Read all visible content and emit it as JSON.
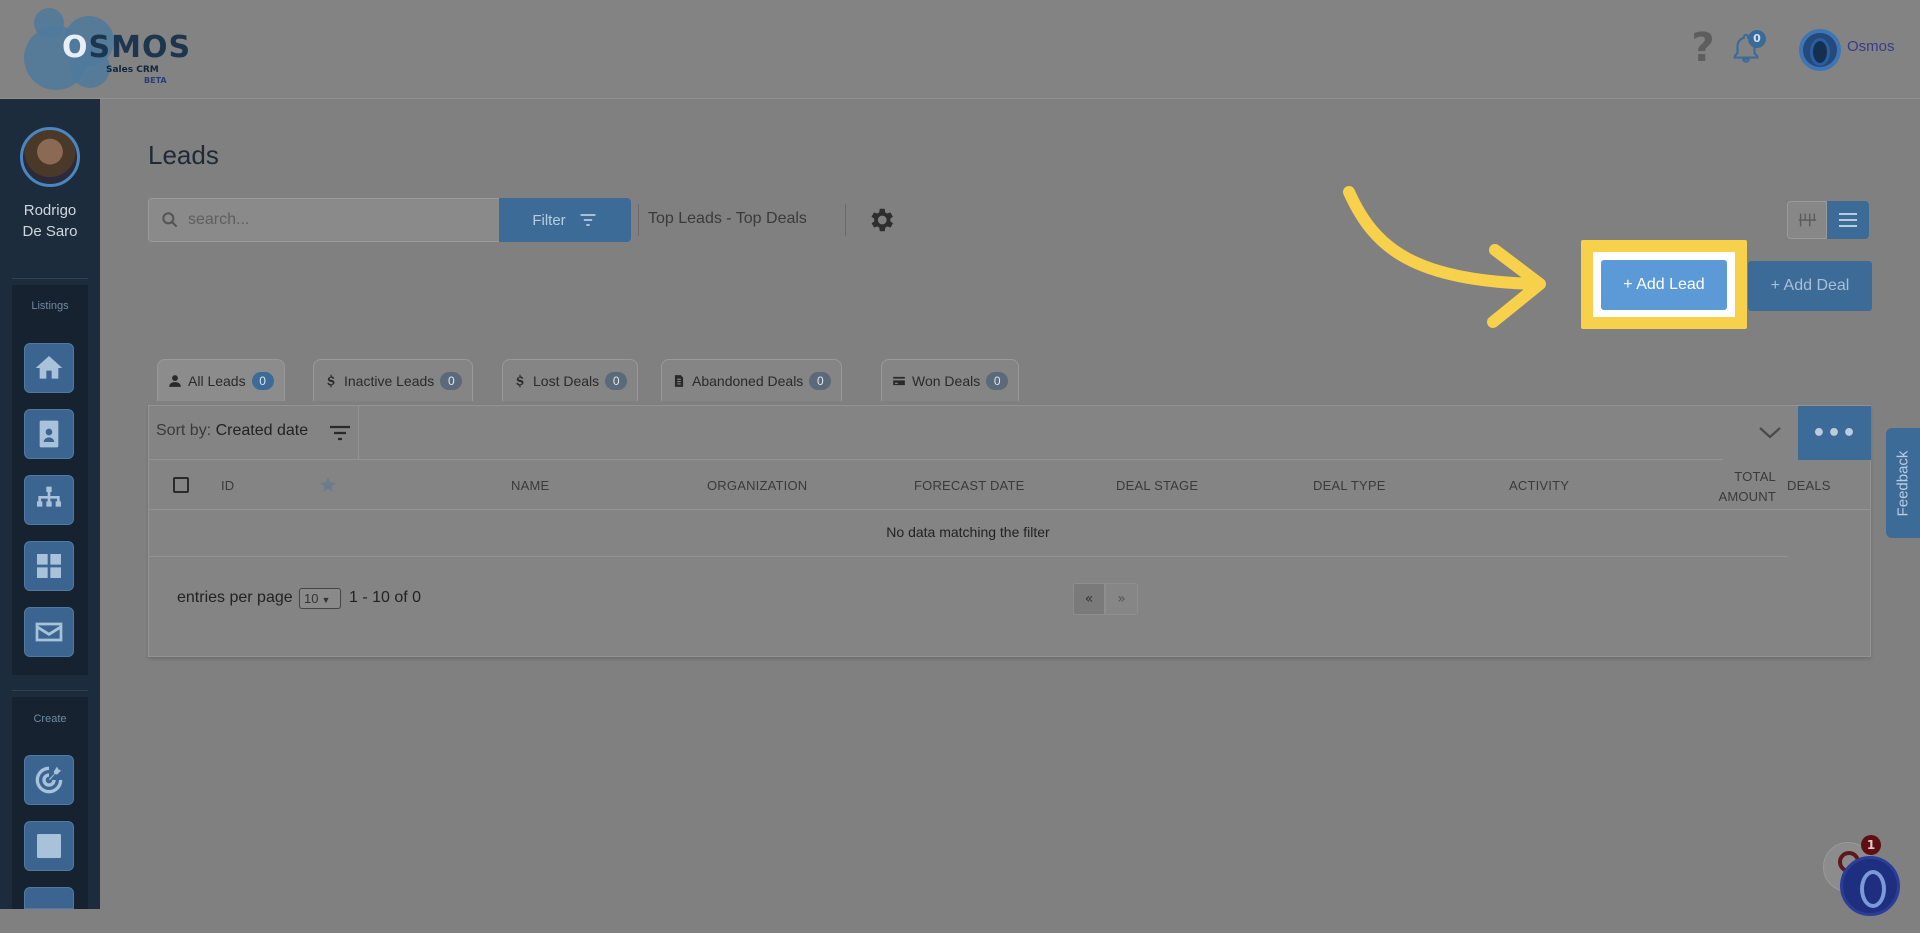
{
  "header": {
    "logo_text": "OSMOS",
    "logo_sub": "Sales CRM",
    "logo_beta": "BETA",
    "notifications_count": "0",
    "user_name": "Osmos"
  },
  "sidebar": {
    "user_name_line1": "Rodrigo",
    "user_name_line2": "De Saro",
    "listings_label": "Listings",
    "create_label": "Create",
    "listing_icons": [
      "home-icon",
      "contact-card-icon",
      "org-chart-icon",
      "dashboard-grid-icon",
      "mail-icon"
    ],
    "create_icons": [
      "target-icon",
      "checklist-icon"
    ]
  },
  "main": {
    "title": "Leads",
    "search": {
      "placeholder": "search...",
      "value": ""
    },
    "filter_label": "Filter",
    "top_link": "Top Leads - Top Deals",
    "add_lead_label": "+ Add Lead",
    "add_deal_label": "+ Add Deal"
  },
  "tabs": [
    {
      "label": "All Leads",
      "count": "0",
      "icon": "person-icon",
      "active": true
    },
    {
      "label": "Inactive Leads",
      "count": "0",
      "icon": "dollar-icon",
      "active": false
    },
    {
      "label": "Lost Deals",
      "count": "0",
      "icon": "dollar-icon",
      "active": false
    },
    {
      "label": "Abandoned Deals",
      "count": "0",
      "icon": "file-icon",
      "active": false
    },
    {
      "label": "Won Deals",
      "count": "0",
      "icon": "credit-card-icon",
      "active": false
    }
  ],
  "table": {
    "sort_prefix": "Sort by:",
    "sort_value": "Created date",
    "more_label": "•••",
    "columns": [
      "ID",
      "NAME",
      "ORGANIZATION",
      "FORECAST DATE",
      "DEAL STAGE",
      "DEAL TYPE",
      "ACTIVITY",
      "TOTAL",
      "AMOUNT",
      "DEALS"
    ],
    "empty_message": "No data matching the filter",
    "entries_label": "entries per page",
    "entries_value": "10",
    "range_text": "1 - 10 of 0",
    "prev_label": "«",
    "next_label": "»"
  },
  "feedback_label": "Feedback",
  "chat_badge": "1",
  "colors": {
    "accent": "#3d6b98",
    "highlight": "#f8d14c",
    "add_lead": "#5b9ad6"
  }
}
